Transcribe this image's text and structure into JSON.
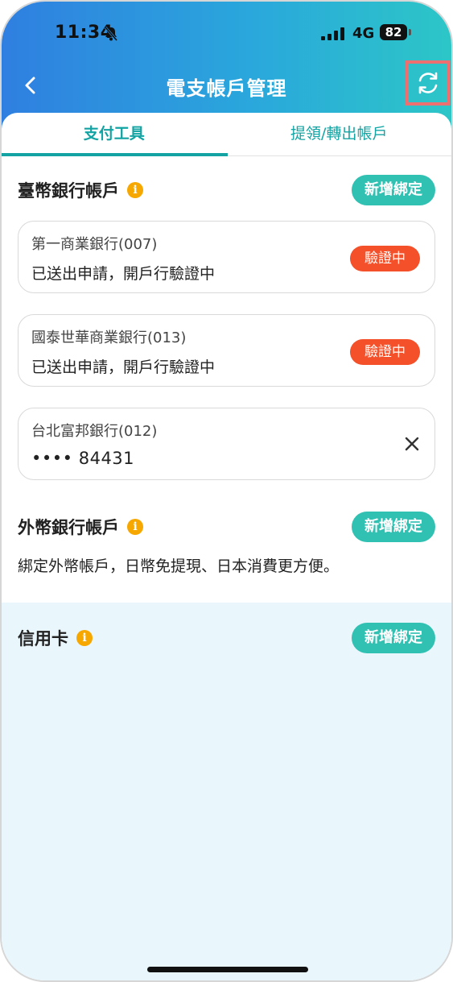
{
  "status_bar": {
    "time": "11:34",
    "network": "4G",
    "battery": "82"
  },
  "nav": {
    "title": "電支帳戶管理"
  },
  "tabs": [
    {
      "label": "支付工具",
      "active": true
    },
    {
      "label": "提領/轉出帳戶",
      "active": false
    }
  ],
  "twd_section": {
    "title": "臺幣銀行帳戶",
    "add_label": "新增綁定",
    "accounts": [
      {
        "bank": "第一商業銀行(007)",
        "status": "已送出申請，開戶行驗證中",
        "badge": "驗證中"
      },
      {
        "bank": "國泰世華商業銀行(013)",
        "status": "已送出申請，開戶行驗證中",
        "badge": "驗證中"
      },
      {
        "bank": "台北富邦銀行(012)",
        "account_masked": "•••• 84431"
      }
    ]
  },
  "foreign_section": {
    "title": "外幣銀行帳戶",
    "add_label": "新增綁定",
    "description": "綁定外幣帳戶，日幣免提現、日本消費更方便。"
  },
  "credit_section": {
    "title": "信用卡",
    "add_label": "新增綁定"
  },
  "colors": {
    "accent": "#31c1b3",
    "tab_text": "#14a3a3",
    "badge": "#f4502a",
    "info": "#f6a800",
    "credit_bg": "#e9f6fb"
  }
}
